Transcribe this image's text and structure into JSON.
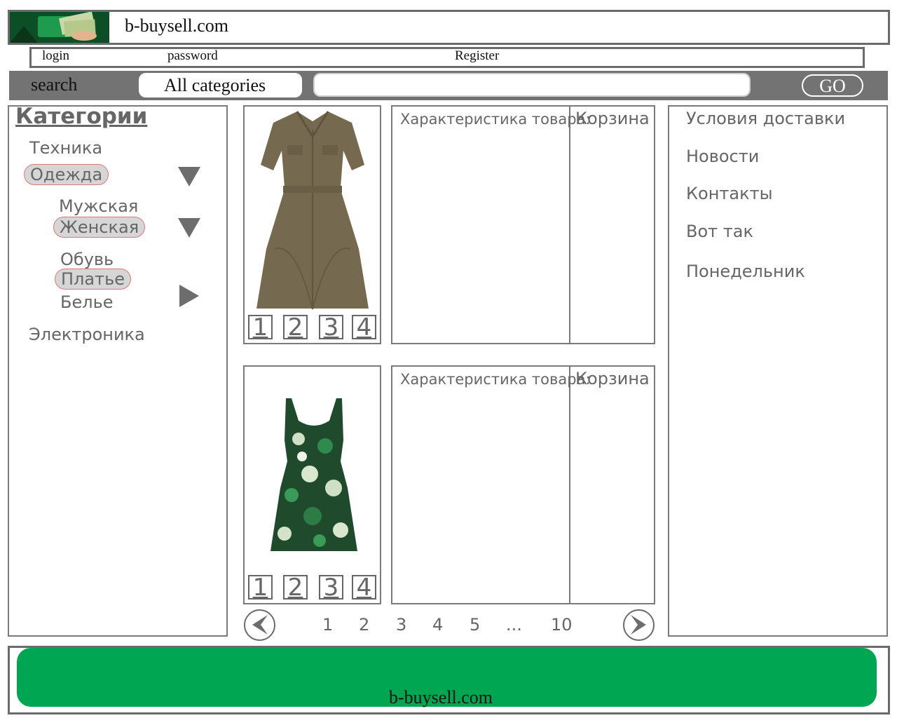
{
  "header": {
    "site_title": "b-buysell.com"
  },
  "auth": {
    "login": "login",
    "password": "password",
    "register": "Register"
  },
  "search": {
    "label": "search",
    "category": "All categories",
    "query": "",
    "go": "GO"
  },
  "categories": {
    "title": "Категории",
    "items": [
      {
        "label": "Техника"
      },
      {
        "label": "Одежда",
        "selected": true
      },
      {
        "label": "Мужская"
      },
      {
        "label": "Женская",
        "selected": true
      },
      {
        "label": "Обувь"
      },
      {
        "label": "Платье",
        "selected": true
      },
      {
        "label": "Белье"
      },
      {
        "label": "Электроника"
      }
    ]
  },
  "products": [
    {
      "description_title": "Характеристика товара:",
      "cart_title": "Корзина",
      "thumbs": [
        "1",
        "2",
        "3",
        "4"
      ]
    },
    {
      "description_title": "Характеристика товара:",
      "cart_title": "Корзина",
      "thumbs": [
        "1",
        "2",
        "3",
        "4"
      ]
    }
  ],
  "pager": {
    "pages": [
      "1",
      "2",
      "3",
      "4",
      "5",
      "...",
      "10"
    ]
  },
  "info_links": [
    "Условия доставки",
    "Новости",
    "Контакты",
    "Вот так",
    "Понедельник"
  ],
  "footer": {
    "site_title": "b-buysell.com"
  },
  "colors": {
    "accent_green": "#00a651",
    "border_gray": "#6b6b6b",
    "search_bar": "#737373"
  }
}
